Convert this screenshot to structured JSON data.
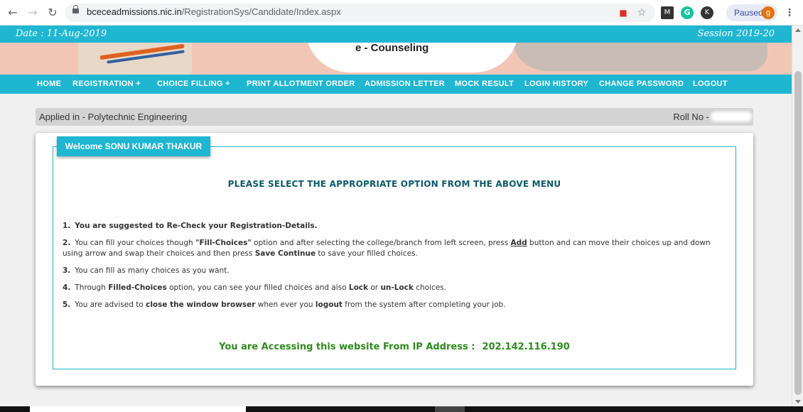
{
  "browser": {
    "url_host": "bceceadmissions.nic.in",
    "url_path": "/RegistrationSys/Candidate/Index.aspx",
    "paused_label": "Paused",
    "avatar_letter": "g",
    "ext_g_letter": "G",
    "ext_k_letter": "K"
  },
  "header": {
    "date": "Date : 11-Aug-2019",
    "session": "Session 2019-20",
    "title": "e - Counseling"
  },
  "menu": {
    "items": [
      {
        "label": "HOME"
      },
      {
        "label": "REGISTRATION +"
      },
      {
        "label": "CHOICE FILLING +"
      },
      {
        "label": "PRINT ALLOTMENT ORDER"
      },
      {
        "label": "ADMISSION LETTER"
      },
      {
        "label": "MOCK RESULT"
      },
      {
        "label": "LOGIN HISTORY"
      },
      {
        "label": "CHANGE PASSWORD"
      },
      {
        "label": "LOGOUT"
      }
    ]
  },
  "status": {
    "applied": "Applied in - Polytechnic Engineering",
    "roll_label": "Roll No -"
  },
  "main": {
    "welcome": "Welcome SONU KUMAR THAKUR",
    "heading": "PLEASE SELECT THE APPROPRIATE OPTION FROM THE ABOVE MENU",
    "instructions": {
      "i1_num": "1.",
      "i1_text": "You are suggested to Re-Check your Registration-Details.",
      "i2_num": "2.",
      "i2_a": "You can fill your choices though ",
      "i2_b": "\"Fill-Choices\"",
      "i2_c": " option and after selecting the college/branch from left screen, press ",
      "i2_d": "Add",
      "i2_e": " button and can move their choices up and down using arrow and swap their choices and then press ",
      "i2_f": "Save Continue",
      "i2_g": " to save your filled choices.",
      "i3_num": "3.",
      "i3_text": "You can fill as many choices as you want.",
      "i4_num": "4.",
      "i4_a": "Through ",
      "i4_b": "Filled-Choices",
      "i4_c": " option, you can see your filled choices and also ",
      "i4_d": "Lock",
      "i4_e": " or ",
      "i4_f": "un-Lock",
      "i4_g": " choices.",
      "i5_num": "5.",
      "i5_a": "You are advised to ",
      "i5_b": "close the window browser",
      "i5_c": " when ever you ",
      "i5_d": "logout",
      "i5_e": " from the system after completing your job."
    },
    "ip_label": "You are Accessing this website From IP Address :",
    "ip_value": "202.142.116.190"
  },
  "colors": {
    "accent": "#1fb6d2",
    "heading": "#0b5c6b",
    "ip_text": "#2e8b1e"
  }
}
